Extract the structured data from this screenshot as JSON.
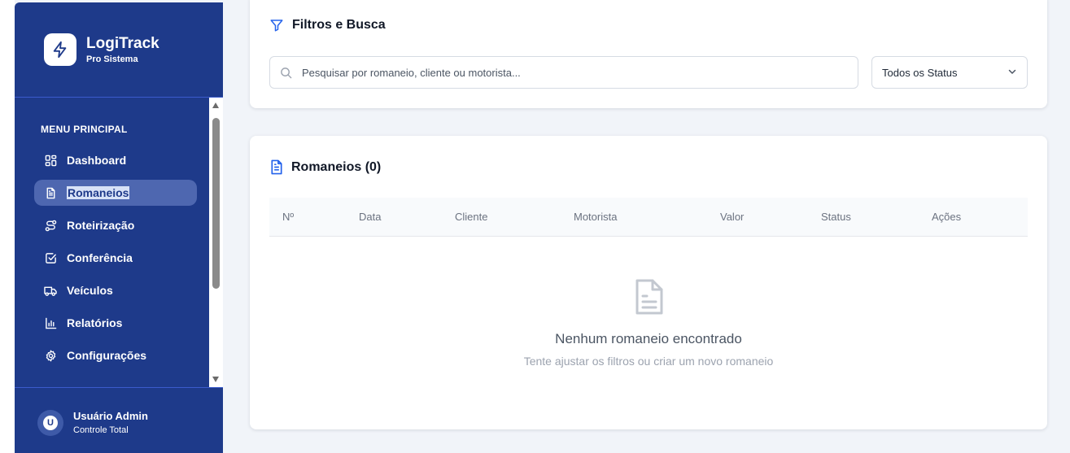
{
  "brand": {
    "name": "LogiTrack",
    "subtitle": "Pro Sistema"
  },
  "sidebar": {
    "section_title": "MENU PRINCIPAL",
    "items": [
      {
        "label": "Dashboard",
        "icon": "grid-icon"
      },
      {
        "label": "Romaneios",
        "icon": "document-icon",
        "active": true
      },
      {
        "label": "Roteirização",
        "icon": "route-icon"
      },
      {
        "label": "Conferência",
        "icon": "checkbox-icon"
      },
      {
        "label": "Veículos",
        "icon": "truck-icon"
      },
      {
        "label": "Relatórios",
        "icon": "bar-chart-icon"
      },
      {
        "label": "Configurações",
        "icon": "gear-icon"
      }
    ]
  },
  "user": {
    "initial": "U",
    "name": "Usuário Admin",
    "role": "Controle Total"
  },
  "filters": {
    "title": "Filtros e Busca",
    "search_placeholder": "Pesquisar por romaneio, cliente ou motorista...",
    "status_select": "Todos os Status"
  },
  "table": {
    "title": "Romaneios (0)",
    "columns": [
      "Nº",
      "Data",
      "Cliente",
      "Motorista",
      "Valor",
      "Status",
      "Ações"
    ],
    "empty_title": "Nenhum romaneio encontrado",
    "empty_subtitle": "Tente ajustar os filtros ou criar um novo romaneio"
  },
  "colors": {
    "sidebar_bg": "#1e3a8a",
    "active_item_bg": "#4e67b0",
    "accent_blue": "#2563eb",
    "page_bg": "#f1f4f9"
  }
}
